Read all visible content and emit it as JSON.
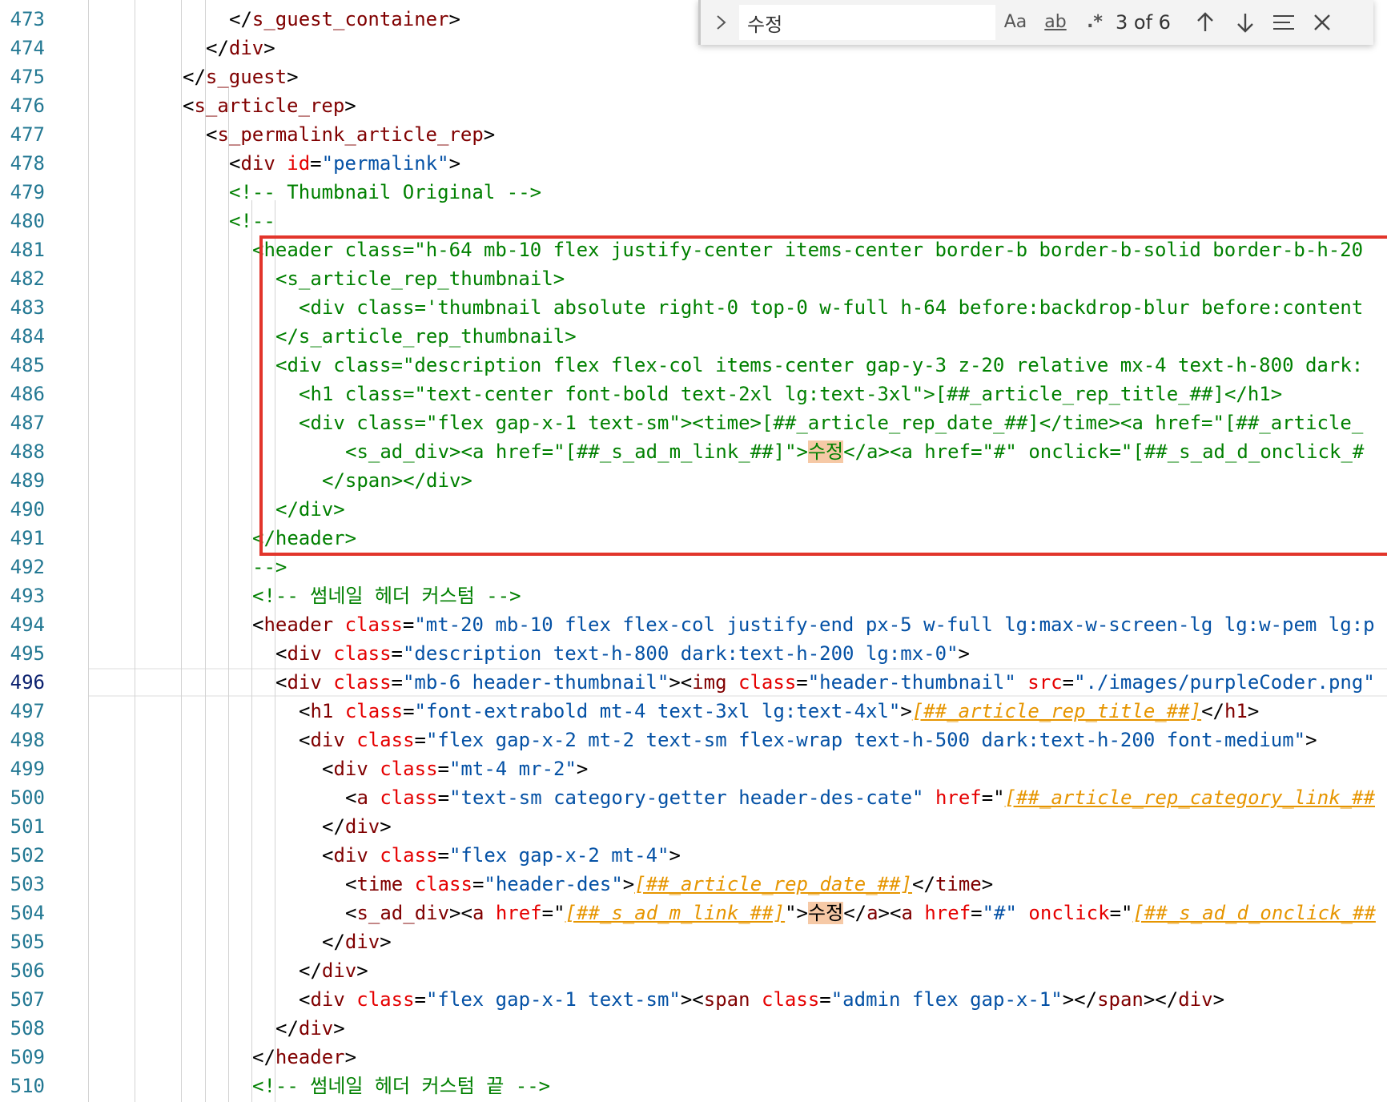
{
  "editor": {
    "active_line": "496",
    "lines": [
      {
        "n": "473",
        "indent": 12,
        "tokens": [
          [
            "p",
            "</"
          ],
          [
            "tag",
            "s_guest_container"
          ],
          [
            "p",
            ">"
          ]
        ]
      },
      {
        "n": "474",
        "indent": 10,
        "tokens": [
          [
            "p",
            "</"
          ],
          [
            "tag",
            "div"
          ],
          [
            "p",
            ">"
          ]
        ]
      },
      {
        "n": "475",
        "indent": 8,
        "tokens": [
          [
            "p",
            "</"
          ],
          [
            "tag",
            "s_guest"
          ],
          [
            "p",
            ">"
          ]
        ]
      },
      {
        "n": "476",
        "indent": 8,
        "tokens": [
          [
            "p",
            "<"
          ],
          [
            "tag",
            "s_article_rep"
          ],
          [
            "p",
            ">"
          ]
        ]
      },
      {
        "n": "477",
        "indent": 10,
        "tokens": [
          [
            "p",
            "<"
          ],
          [
            "tag",
            "s_permalink_article_rep"
          ],
          [
            "p",
            ">"
          ]
        ]
      },
      {
        "n": "478",
        "indent": 12,
        "tokens": [
          [
            "p",
            "<"
          ],
          [
            "tag",
            "div"
          ],
          [
            "p",
            " "
          ],
          [
            "attr",
            "id"
          ],
          [
            "p",
            "="
          ],
          [
            "str",
            "\"permalink\""
          ],
          [
            "p",
            ">"
          ]
        ]
      },
      {
        "n": "479",
        "indent": 12,
        "tokens": [
          [
            "cm",
            "<!-- Thumbnail Original -->"
          ]
        ]
      },
      {
        "n": "480",
        "indent": 12,
        "tokens": [
          [
            "cm",
            "<!--"
          ]
        ]
      },
      {
        "n": "481",
        "indent": 14,
        "tokens": [
          [
            "cm",
            "<header class=\"h-64 mb-10 flex justify-center items-center border-b border-b-solid border-b-h-20"
          ]
        ]
      },
      {
        "n": "482",
        "indent": 16,
        "tokens": [
          [
            "cm",
            "<s_article_rep_thumbnail>"
          ]
        ]
      },
      {
        "n": "483",
        "indent": 18,
        "tokens": [
          [
            "cm",
            "<div class='thumbnail absolute right-0 top-0 w-full h-64 before:backdrop-blur before:content"
          ]
        ]
      },
      {
        "n": "484",
        "indent": 16,
        "tokens": [
          [
            "cm",
            "</s_article_rep_thumbnail>"
          ]
        ]
      },
      {
        "n": "485",
        "indent": 16,
        "tokens": [
          [
            "cm",
            "<div class=\"description flex flex-col items-center gap-y-3 z-20 relative mx-4 text-h-800 dark:"
          ]
        ]
      },
      {
        "n": "486",
        "indent": 18,
        "tokens": [
          [
            "cm",
            "<h1 class=\"text-center font-bold text-2xl lg:text-3xl\">[##_article_rep_title_##]</h1>"
          ]
        ]
      },
      {
        "n": "487",
        "indent": 18,
        "tokens": [
          [
            "cm",
            "<div class=\"flex gap-x-1 text-sm\"><time>[##_article_rep_date_##]</time><a href=\"[##_article_"
          ]
        ]
      },
      {
        "n": "488",
        "indent": 22,
        "tokens": [
          [
            "cm",
            "<s_ad_div><a href=\"[##_s_ad_m_link_##]\">"
          ],
          [
            "cmhl",
            "수정"
          ],
          [
            "cm",
            "</a><a href=\"#\" onclick=\"[##_s_ad_d_onclick_#"
          ]
        ]
      },
      {
        "n": "489",
        "indent": 20,
        "tokens": [
          [
            "cm",
            "</span></div>"
          ]
        ]
      },
      {
        "n": "490",
        "indent": 16,
        "tokens": [
          [
            "cm",
            "</div>"
          ]
        ]
      },
      {
        "n": "491",
        "indent": 14,
        "tokens": [
          [
            "cm",
            "</header>"
          ]
        ]
      },
      {
        "n": "492",
        "indent": 14,
        "tokens": [
          [
            "cm",
            "-->"
          ]
        ]
      },
      {
        "n": "493",
        "indent": 14,
        "tokens": [
          [
            "cm",
            "<!-- 썸네일 헤더 커스텀 -->"
          ]
        ]
      },
      {
        "n": "494",
        "indent": 14,
        "tokens": [
          [
            "p",
            "<"
          ],
          [
            "tag",
            "header"
          ],
          [
            "p",
            " "
          ],
          [
            "attr",
            "class"
          ],
          [
            "p",
            "="
          ],
          [
            "str",
            "\"mt-20 mb-10 flex flex-col justify-end px-5 w-full lg:max-w-screen-lg lg:w-pem lg:p"
          ]
        ]
      },
      {
        "n": "495",
        "indent": 16,
        "tokens": [
          [
            "p",
            "<"
          ],
          [
            "tag",
            "div"
          ],
          [
            "p",
            " "
          ],
          [
            "attr",
            "class"
          ],
          [
            "p",
            "="
          ],
          [
            "str",
            "\"description text-h-800 dark:text-h-200 lg:mx-0\""
          ],
          [
            "p",
            ">"
          ]
        ]
      },
      {
        "n": "496",
        "indent": 16,
        "tokens": [
          [
            "p",
            "<"
          ],
          [
            "tag",
            "div"
          ],
          [
            "p",
            " "
          ],
          [
            "attr",
            "class"
          ],
          [
            "p",
            "="
          ],
          [
            "str",
            "\"mb-6 header-thumbnail\""
          ],
          [
            "p",
            "><"
          ],
          [
            "tag",
            "img"
          ],
          [
            "p",
            " "
          ],
          [
            "attr",
            "class"
          ],
          [
            "p",
            "="
          ],
          [
            "str",
            "\"header-thumbnail\""
          ],
          [
            "p",
            " "
          ],
          [
            "attr",
            "src"
          ],
          [
            "p",
            "="
          ],
          [
            "str",
            "\"./images/purpleCoder.png\""
          ]
        ]
      },
      {
        "n": "497",
        "indent": 18,
        "tokens": [
          [
            "p",
            "<"
          ],
          [
            "tag",
            "h1"
          ],
          [
            "p",
            " "
          ],
          [
            "attr",
            "class"
          ],
          [
            "p",
            "="
          ],
          [
            "str",
            "\"font-extrabold mt-4 text-3xl lg:text-4xl\""
          ],
          [
            "p",
            ">"
          ],
          [
            "tpl",
            "[##_article_rep_title_##]"
          ],
          [
            "p",
            "</"
          ],
          [
            "tag",
            "h1"
          ],
          [
            "p",
            ">"
          ]
        ]
      },
      {
        "n": "498",
        "indent": 18,
        "tokens": [
          [
            "p",
            "<"
          ],
          [
            "tag",
            "div"
          ],
          [
            "p",
            " "
          ],
          [
            "attr",
            "class"
          ],
          [
            "p",
            "="
          ],
          [
            "str",
            "\"flex gap-x-2 mt-2 text-sm flex-wrap text-h-500 dark:text-h-200 font-medium\""
          ],
          [
            "p",
            ">"
          ]
        ]
      },
      {
        "n": "499",
        "indent": 20,
        "tokens": [
          [
            "p",
            "<"
          ],
          [
            "tag",
            "div"
          ],
          [
            "p",
            " "
          ],
          [
            "attr",
            "class"
          ],
          [
            "p",
            "="
          ],
          [
            "str",
            "\"mt-4 mr-2\""
          ],
          [
            "p",
            ">"
          ]
        ]
      },
      {
        "n": "500",
        "indent": 22,
        "tokens": [
          [
            "p",
            "<"
          ],
          [
            "tag",
            "a"
          ],
          [
            "p",
            " "
          ],
          [
            "attr",
            "class"
          ],
          [
            "p",
            "="
          ],
          [
            "str",
            "\"text-sm category-getter header-des-cate\""
          ],
          [
            "p",
            " "
          ],
          [
            "attr",
            "href"
          ],
          [
            "p",
            "=\""
          ],
          [
            "tpl",
            "[##_article_rep_category_link_##"
          ]
        ]
      },
      {
        "n": "501",
        "indent": 20,
        "tokens": [
          [
            "p",
            "</"
          ],
          [
            "tag",
            "div"
          ],
          [
            "p",
            ">"
          ]
        ]
      },
      {
        "n": "502",
        "indent": 20,
        "tokens": [
          [
            "p",
            "<"
          ],
          [
            "tag",
            "div"
          ],
          [
            "p",
            " "
          ],
          [
            "attr",
            "class"
          ],
          [
            "p",
            "="
          ],
          [
            "str",
            "\"flex gap-x-2 mt-4\""
          ],
          [
            "p",
            ">"
          ]
        ]
      },
      {
        "n": "503",
        "indent": 22,
        "tokens": [
          [
            "p",
            "<"
          ],
          [
            "tag",
            "time"
          ],
          [
            "p",
            " "
          ],
          [
            "attr",
            "class"
          ],
          [
            "p",
            "="
          ],
          [
            "str",
            "\"header-des\""
          ],
          [
            "p",
            ">"
          ],
          [
            "tpl",
            "[##_article_rep_date_##]"
          ],
          [
            "p",
            "</"
          ],
          [
            "tag",
            "time"
          ],
          [
            "p",
            ">"
          ]
        ]
      },
      {
        "n": "504",
        "indent": 22,
        "tokens": [
          [
            "p",
            "<"
          ],
          [
            "tag",
            "s_ad_div"
          ],
          [
            "p",
            "><"
          ],
          [
            "tag",
            "a"
          ],
          [
            "p",
            " "
          ],
          [
            "attr",
            "href"
          ],
          [
            "p",
            "=\""
          ],
          [
            "tpl",
            "[##_s_ad_m_link_##]"
          ],
          [
            "p",
            "\">"
          ],
          [
            "hl",
            "수정"
          ],
          [
            "p",
            "</"
          ],
          [
            "tag",
            "a"
          ],
          [
            "p",
            "><"
          ],
          [
            "tag",
            "a"
          ],
          [
            "p",
            " "
          ],
          [
            "attr",
            "href"
          ],
          [
            "p",
            "="
          ],
          [
            "str",
            "\"#\""
          ],
          [
            "p",
            " "
          ],
          [
            "attr",
            "onclick"
          ],
          [
            "p",
            "=\""
          ],
          [
            "tpl",
            "[##_s_ad_d_onclick_##"
          ]
        ]
      },
      {
        "n": "505",
        "indent": 20,
        "tokens": [
          [
            "p",
            "</"
          ],
          [
            "tag",
            "div"
          ],
          [
            "p",
            ">"
          ]
        ]
      },
      {
        "n": "506",
        "indent": 18,
        "tokens": [
          [
            "p",
            "</"
          ],
          [
            "tag",
            "div"
          ],
          [
            "p",
            ">"
          ]
        ]
      },
      {
        "n": "507",
        "indent": 18,
        "tokens": [
          [
            "p",
            "<"
          ],
          [
            "tag",
            "div"
          ],
          [
            "p",
            " "
          ],
          [
            "attr",
            "class"
          ],
          [
            "p",
            "="
          ],
          [
            "str",
            "\"flex gap-x-1 text-sm\""
          ],
          [
            "p",
            "><"
          ],
          [
            "tag",
            "span"
          ],
          [
            "p",
            " "
          ],
          [
            "attr",
            "class"
          ],
          [
            "p",
            "="
          ],
          [
            "str",
            "\"admin flex gap-x-1\""
          ],
          [
            "p",
            "></"
          ],
          [
            "tag",
            "span"
          ],
          [
            "p",
            "></"
          ],
          [
            "tag",
            "div"
          ],
          [
            "p",
            ">"
          ]
        ]
      },
      {
        "n": "508",
        "indent": 16,
        "tokens": [
          [
            "p",
            "</"
          ],
          [
            "tag",
            "div"
          ],
          [
            "p",
            ">"
          ]
        ]
      },
      {
        "n": "509",
        "indent": 14,
        "tokens": [
          [
            "p",
            "</"
          ],
          [
            "tag",
            "header"
          ],
          [
            "p",
            ">"
          ]
        ]
      },
      {
        "n": "510",
        "indent": 14,
        "tokens": [
          [
            "cm",
            "<!-- 썸네일 헤더 커스텀 끝 -->"
          ]
        ]
      }
    ]
  },
  "find_widget": {
    "query": "수정",
    "match_case_label": "Aa",
    "whole_word_label": "ab",
    "regex_label": ".*",
    "result_count": "3 of 6",
    "icons": {
      "toggle": "chevron-right-icon",
      "previous": "arrow-up-icon",
      "next": "arrow-down-icon",
      "selection": "find-in-selection-icon",
      "close": "close-icon"
    }
  },
  "colors": {
    "line_number": "#237893",
    "tag": "#800000",
    "attribute": "#e50000",
    "string": "#0451a5",
    "comment": "#008000",
    "template": "#e69500",
    "match_highlight": "#f6c9a6",
    "annotation_box": "#e2352b"
  }
}
